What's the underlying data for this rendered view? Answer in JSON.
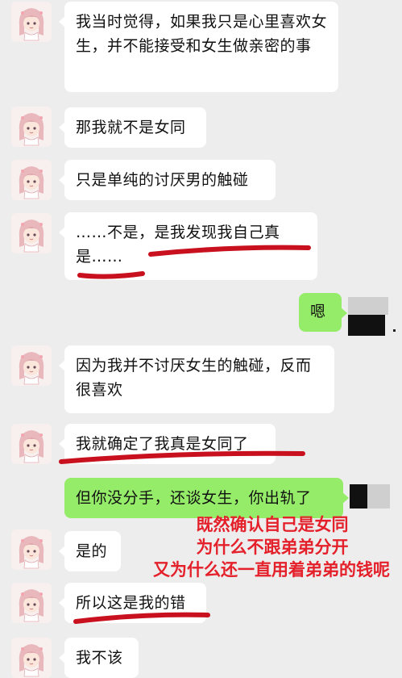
{
  "messages": [
    {
      "side": "left",
      "text": "我当时觉得，如果我只是心里喜欢女生，并不能接受和女生做亲密的事"
    },
    {
      "side": "left",
      "text": "那我就不是女同"
    },
    {
      "side": "left",
      "text": "只是单纯的讨厌男的触碰"
    },
    {
      "side": "left",
      "text": "……不是，是我发现我自己真是……"
    },
    {
      "side": "right",
      "text": "嗯"
    },
    {
      "side": "left",
      "text": "因为我并不讨厌女生的触碰，反而很喜欢"
    },
    {
      "side": "left",
      "text": "我就确定了我真是女同了"
    },
    {
      "side": "right",
      "text": "但你没分手，还谈女生，你出轨了"
    },
    {
      "side": "left",
      "text": "是的"
    },
    {
      "side": "left",
      "text": "所以这是我的错"
    },
    {
      "side": "left",
      "text": "我不该"
    }
  ],
  "annotation": {
    "lines": [
      "既然确认自己是女同",
      "为什么不跟弟弟分开",
      "又为什么还一直用着弟弟的钱呢"
    ],
    "color": "#e4202a"
  },
  "colors": {
    "background": "#ededed",
    "bubble_left": "#ffffff",
    "bubble_right": "#95ec69",
    "underline": "#c8101e"
  }
}
